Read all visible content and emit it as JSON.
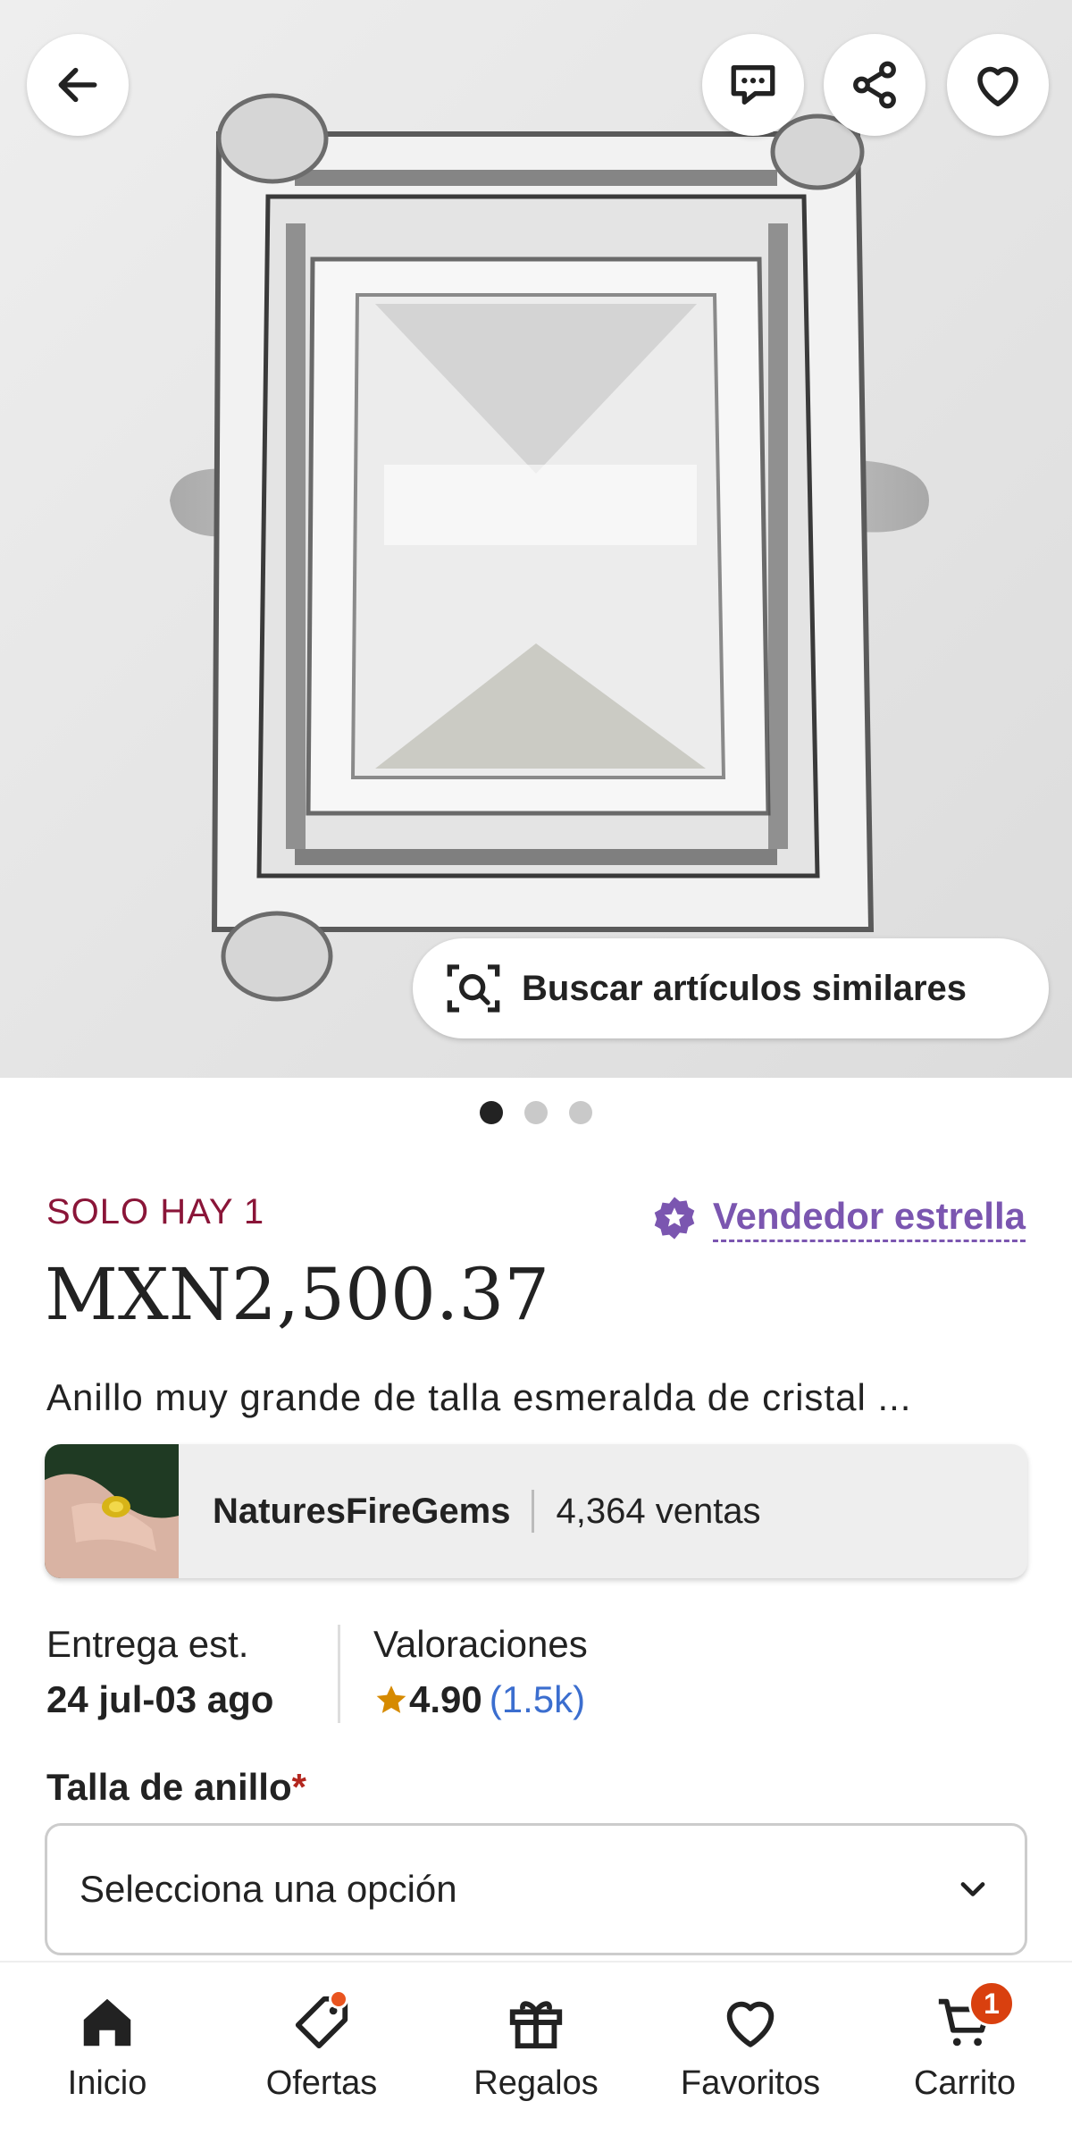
{
  "hero": {
    "similar_label": "Buscar artículos similares",
    "dots": [
      true,
      false,
      false
    ]
  },
  "product": {
    "stock_label": "SOLO HAY 1",
    "star_seller_label": "Vendedor estrella",
    "price": "MXN2,500.37",
    "title": "Anillo muy grande de talla esmeralda de cristal ..."
  },
  "shop": {
    "name": "NaturesFireGems",
    "sales": "4,364 ventas"
  },
  "delivery": {
    "label": "Entrega est.",
    "value": "24 jul-03 ago"
  },
  "ratings": {
    "label": "Valoraciones",
    "score": "4.90",
    "count": "(1.5k)"
  },
  "ring_size": {
    "label": "Talla de anillo",
    "required_mark": "*",
    "placeholder": "Selecciona una opción"
  },
  "bottom_nav": {
    "items": [
      {
        "label": "Inicio",
        "icon": "home-icon"
      },
      {
        "label": "Ofertas",
        "icon": "tag-icon"
      },
      {
        "label": "Regalos",
        "icon": "gift-icon"
      },
      {
        "label": "Favoritos",
        "icon": "heart-icon"
      },
      {
        "label": "Carrito",
        "icon": "cart-icon"
      }
    ],
    "cart_badge": "1"
  },
  "colors": {
    "stock": "#8a1538",
    "star_seller": "#7b56b0",
    "rating_link": "#3b6ecf",
    "badge": "#d9400f"
  }
}
